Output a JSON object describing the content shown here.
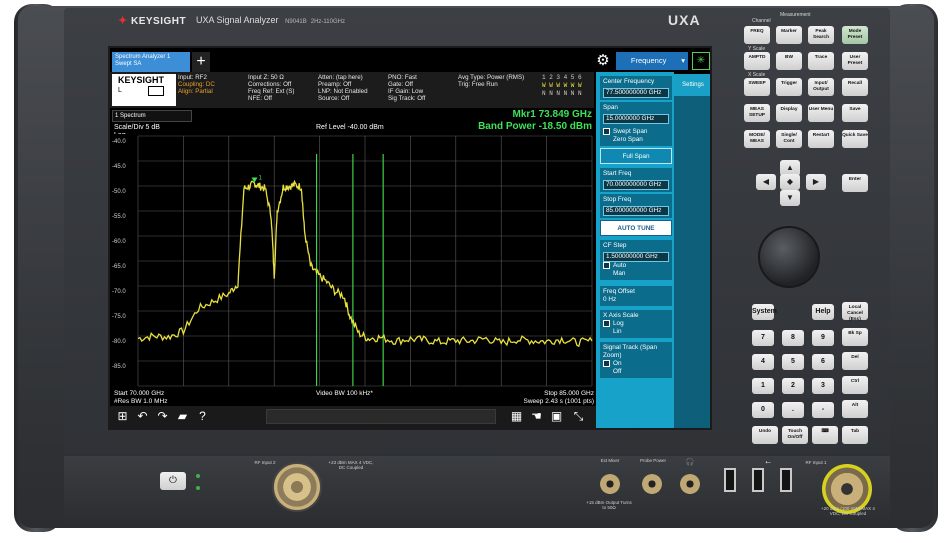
{
  "instrument": {
    "brand": "KEYSIGHT",
    "model_title": "UXA Signal Analyzer",
    "model_number": "N9041B",
    "freq_range": "2Hz-110GHz",
    "series": "UXA"
  },
  "screen": {
    "tab_label": "Spectrum Analyzer 1 Swept SA",
    "add_tab": "+",
    "logo_text": "KEYSIGHT",
    "logo_letter": "L",
    "status_cols": [
      {
        "l1": "Input: RF2",
        "l2": "Coupling: DC",
        "l3": "Align: Partial"
      },
      {
        "l1": "Input Z: 50 Ω",
        "l2": "Corrections: Off",
        "l3": "Freq Ref: Ext (S)",
        "l4": "NFE: Off"
      },
      {
        "l1": "Atten: (tap here)",
        "l2": "Preamp: Off",
        "l3": "LNP: Not Enabled",
        "l4": "Source: Off"
      },
      {
        "l1": "PNO: Fast",
        "l2": "Gate: Off",
        "l3": "IF Gain: Low",
        "l4": "Sig Track: Off"
      },
      {
        "l1": "Avg Type: Power (RMS)",
        "l2": "Trig: Free Run"
      }
    ],
    "trace_numbers": "1 2 3 4 5 6",
    "trace_row2": "W W W W W W",
    "trace_row3": "N N N N N N",
    "active_menu": "Frequency",
    "settings_tab": "Settings",
    "spectrum_select": "1 Spectrum",
    "scale_div": "Scale/Div 5 dB",
    "scale_type": "Log",
    "ref_level": "Ref Level -40.00 dBm",
    "marker_readout": "Mkr1  73.849 GHz",
    "band_power": "Band Power  -18.50 dBm",
    "start_freq_label": "Start 70.000 GHz",
    "res_bw": "#Res BW 1.0 MHz",
    "video_bw": "Video BW 100 kHz*",
    "stop_freq_label": "Stop 85.000 GHz",
    "sweep": "Sweep 2.43 s (1001 pts)"
  },
  "menu": {
    "center_freq_label": "Center Frequency",
    "center_freq_value": "77.500000000 GHz",
    "span_label": "Span",
    "span_value": "15.0000000 GHz",
    "swept_span": "Swept Span",
    "zero_span": "Zero Span",
    "full_span": "Full Span",
    "start_freq_label": "Start Freq",
    "start_freq_value": "70.000000000 GHz",
    "stop_freq_label": "Stop Freq",
    "stop_freq_value": "85.000000000 GHz",
    "auto_tune": "AUTO TUNE",
    "cf_step_label": "CF Step",
    "cf_step_value": "1.500000000 GHz",
    "auto": "Auto",
    "man": "Man",
    "freq_offset_label": "Freq Offset",
    "freq_offset_value": "0 Hz",
    "x_axis_label": "X Axis Scale",
    "log": "Log",
    "lin": "Lin",
    "signal_track_label": "Signal Track (Span Zoom)",
    "on": "On",
    "off": "Off"
  },
  "chart_data": {
    "type": "line",
    "x_unit": "GHz",
    "xlim": [
      70,
      85
    ],
    "ylim": [
      -90,
      -40
    ],
    "yticks": [
      "-40.0",
      "-45.0",
      "-50.0",
      "-55.0",
      "-60.0",
      "-65.0",
      "-70.0",
      "-75.0",
      "-80.0",
      "-85.0"
    ],
    "grid": true,
    "series_color": "#e8e040",
    "marker_label": "1",
    "band_edges_ghz": [
      75.9,
      77.1,
      78.1
    ],
    "x": [
      70.0,
      70.5,
      71.0,
      71.5,
      72.0,
      72.5,
      73.0,
      73.3,
      73.5,
      73.7,
      73.85,
      74.0,
      74.2,
      74.4,
      74.5,
      74.6,
      74.8,
      75.0,
      75.2,
      75.4,
      75.5,
      75.7,
      75.9,
      76.2,
      76.5,
      76.8,
      77.0,
      77.3,
      77.6,
      78.0,
      78.5,
      79.0,
      79.5,
      80.0,
      80.5,
      81.0,
      81.5,
      82.0,
      82.5,
      83.0,
      83.5,
      84.0,
      84.5,
      85.0
    ],
    "y": [
      -80.5,
      -80.0,
      -80.2,
      -79.0,
      -74.5,
      -73.0,
      -71.5,
      -69.5,
      -50.5,
      -50.0,
      -49.5,
      -50.0,
      -50.5,
      -56.0,
      -68.0,
      -55.0,
      -50.2,
      -50.0,
      -49.8,
      -50.2,
      -59.0,
      -66.0,
      -67.5,
      -69.0,
      -71.0,
      -72.0,
      -76.0,
      -79.5,
      -80.5,
      -80.3,
      -81.0,
      -80.6,
      -80.8,
      -81.2,
      -80.9,
      -81.0,
      -80.5,
      -81.4,
      -80.7,
      -80.9,
      -81.1,
      -80.6,
      -81.3,
      -81.0
    ]
  },
  "keypad": {
    "group_channel": "Channel",
    "group_measurement": "Measurement",
    "group_yscale": "Y Scale",
    "group_xscale": "X Scale",
    "keys": [
      "FREQ",
      "Marker",
      "Peak Search",
      "Mode Preset",
      "AMPTD",
      "BW",
      "Trace",
      "User Preset",
      "SWEEP",
      "Trigger",
      "Input/ Output",
      "Recall",
      "MEAS SETUP",
      "Display",
      "User Menu",
      "Save",
      "MODE/ MEAS",
      "Single/ Cont",
      "Restart",
      "Quick Save"
    ],
    "enter": "Enter",
    "system": "System",
    "help": "Help",
    "local": "Local Cancel (Esc)",
    "bksp": "Bk Sp",
    "del": "Del",
    "ctrl": "Ctrl",
    "alt": "Alt",
    "undo": "Undo",
    "touch_on_off": "Touch On/Off",
    "tab": "Tab",
    "numbers": [
      "7",
      "8",
      "9",
      "4",
      "5",
      "6",
      "1",
      "2",
      "3",
      "0",
      ".",
      "-"
    ]
  },
  "panel": {
    "rf_input2": "RF Input 2",
    "rf_input2_warn": "+23 dBm MAX 4 VDC, DC Coupled",
    "rf_input1": "RF Input 1",
    "rf_input1_warn": "+20 dBm (100 mW) MAX 4 VDC, DC Coupled",
    "ext_mixer": "Ext Mixer",
    "probe_power": "Probe Power",
    "lo_out": "+15 dBm Output Turns to 50Ω"
  }
}
